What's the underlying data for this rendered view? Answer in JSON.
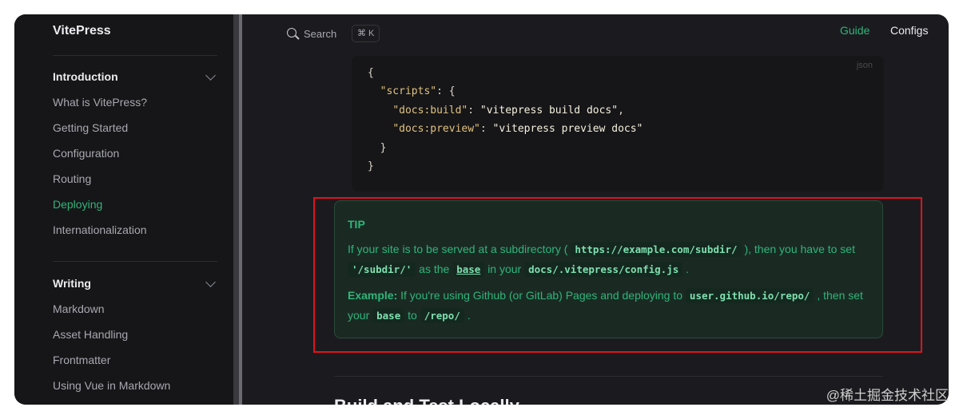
{
  "sidebar": {
    "brand": "VitePress",
    "groups": [
      {
        "title": "Introduction",
        "items": [
          {
            "label": "What is VitePress?"
          },
          {
            "label": "Getting Started"
          },
          {
            "label": "Configuration"
          },
          {
            "label": "Routing"
          },
          {
            "label": "Deploying",
            "active": true
          },
          {
            "label": "Internationalization"
          }
        ]
      },
      {
        "title": "Writing",
        "items": [
          {
            "label": "Markdown"
          },
          {
            "label": "Asset Handling"
          },
          {
            "label": "Frontmatter"
          },
          {
            "label": "Using Vue in Markdown"
          }
        ]
      }
    ]
  },
  "header": {
    "search_label": "Search",
    "search_shortcut": "⌘ K",
    "nav": [
      "Guide",
      "Configs"
    ]
  },
  "code_block": {
    "lang": "json",
    "lines": {
      "l1": "{",
      "l2_key": "\"scripts\"",
      "l2_rest": ": {",
      "l3_key": "\"docs:build\"",
      "l3_sep": ": ",
      "l3_val": "\"vitepress build docs\"",
      "l3_end": ",",
      "l4_key": "\"docs:preview\"",
      "l4_sep": ": ",
      "l4_val": "\"vitepress preview docs\"",
      "l5": "}",
      "l6": "}"
    }
  },
  "tip": {
    "title": "TIP",
    "p1": {
      "t1": "If your site is to be served at a subdirectory (",
      "c1": "https://example.com/subdir/",
      "t2": "), then you have to set",
      "c2": "'/subdir/'",
      "t3": "as the",
      "c3": "base",
      "t4": "in your",
      "c4": "docs/.vitepress/config.js",
      "t5": "."
    },
    "p2": {
      "strong": "Example:",
      "t1": "If you're using Github (or GitLab) Pages and deploying to",
      "c1": "user.github.io/repo/",
      "t2": ", then set your",
      "c2": "base",
      "t3": "to",
      "c3": "/repo/",
      "t4": "."
    }
  },
  "next_heading": "Build and Test Locally",
  "watermark": "@稀土掘金技术社区",
  "colors": {
    "brand_green": "#2fb57a",
    "highlight_red": "#e1121f",
    "background": "#1b1b1f"
  }
}
